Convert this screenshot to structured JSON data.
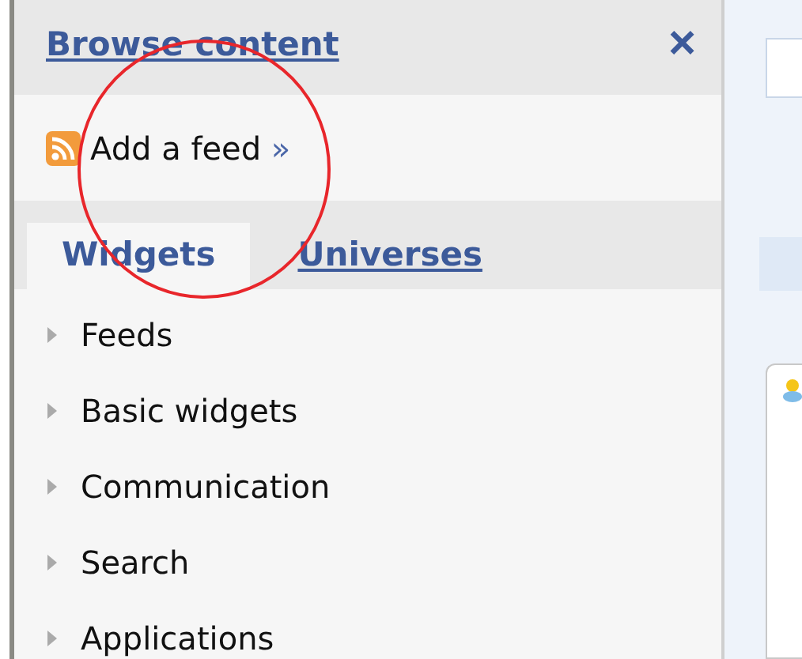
{
  "panel": {
    "title": "Browse content",
    "close": "×",
    "add_feed": {
      "label": "Add a feed",
      "arrow": "»"
    },
    "tabs": [
      {
        "label": "Widgets",
        "selected": true
      },
      {
        "label": "Universes",
        "selected": false
      }
    ],
    "categories": [
      {
        "label": "Feeds",
        "expanded": false
      },
      {
        "label": "Basic widgets",
        "expanded": false
      },
      {
        "label": "Communication",
        "expanded": false
      },
      {
        "label": "Search",
        "expanded": false
      },
      {
        "label": "Applications",
        "expanded": false
      }
    ]
  }
}
